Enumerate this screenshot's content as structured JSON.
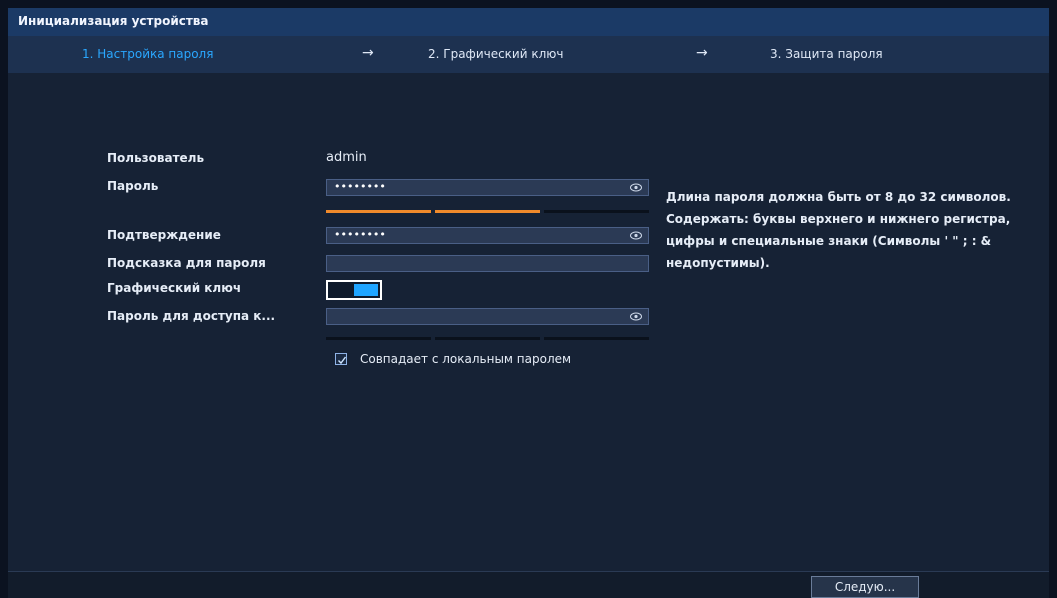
{
  "window": {
    "title": "Инициализация устройства"
  },
  "steps": [
    {
      "label": "1. Настройка пароля",
      "active": true
    },
    {
      "label": "2. Графический ключ",
      "active": false
    },
    {
      "label": "3. Защита пароля",
      "active": false
    }
  ],
  "arrow_glyph": "→",
  "form": {
    "user_label": "Пользователь",
    "user_value": "admin",
    "password_label": "Пароль",
    "password_value": "••••••••",
    "confirm_label": "Подтверждение",
    "confirm_value": "••••••••",
    "hint_label": "Подсказка для пароля",
    "hint_value": "",
    "pattern_label": "Графический ключ",
    "pattern_enabled": true,
    "access_password_label": "Пароль для доступа к...",
    "access_password_value": "",
    "same_as_local_label": "Совпадает с локальным паролем",
    "same_as_local_checked": true
  },
  "password_rules": "Длина пароля должна быть от 8 до 32 символов. Содержать: буквы верхнего и нижнего регистра, цифры и специальные знаки (Символы ' \" ; : & недопустимы).",
  "footer": {
    "next_label": "Следую..."
  },
  "colors": {
    "accent": "#2aa7ff",
    "strength_orange": "#f08a2b",
    "strength_empty": "#0a111c",
    "toggle_on": "#1fa5ff"
  },
  "password_strength_segments_filled": 2,
  "password_strength_segments_total": 3
}
